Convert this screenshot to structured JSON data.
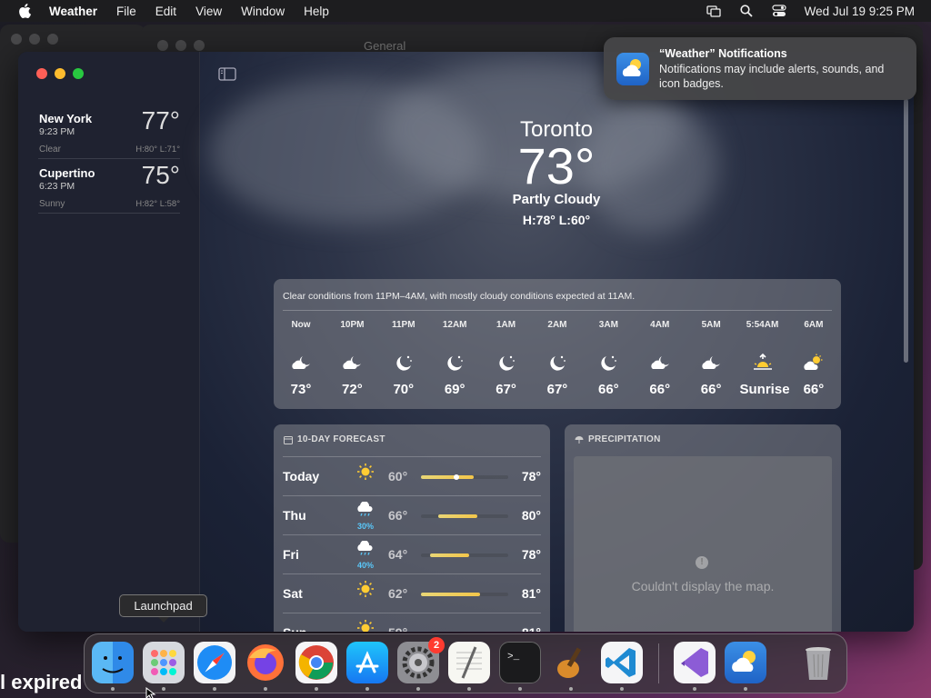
{
  "menubar": {
    "app_name": "Weather",
    "items": [
      "File",
      "Edit",
      "View",
      "Window",
      "Help"
    ],
    "datetime": "Wed Jul 19  9:25 PM"
  },
  "background_window": {
    "title": "General"
  },
  "desktop_text": "l expired",
  "sidebar": {
    "cities": [
      {
        "name": "New York",
        "time": "9:23 PM",
        "temp": "77°",
        "condition": "Clear",
        "hilo": "H:80°  L:71°"
      },
      {
        "name": "Cupertino",
        "time": "6:23 PM",
        "temp": "75°",
        "condition": "Sunny",
        "hilo": "H:82°  L:58°"
      }
    ]
  },
  "current": {
    "location": "Toronto",
    "temp": "73°",
    "condition": "Partly Cloudy",
    "hilo": "H:78°  L:60°"
  },
  "hourly": {
    "summary": "Clear conditions from 11PM–4AM, with mostly cloudy conditions expected at 11AM.",
    "hours": [
      {
        "label": "Now",
        "icon": "cloud-moon-icon",
        "temp": "73°"
      },
      {
        "label": "10PM",
        "icon": "cloud-moon-icon",
        "temp": "72°"
      },
      {
        "label": "11PM",
        "icon": "moon-stars-icon",
        "temp": "70°"
      },
      {
        "label": "12AM",
        "icon": "moon-stars-icon",
        "temp": "69°"
      },
      {
        "label": "1AM",
        "icon": "moon-stars-icon",
        "temp": "67°"
      },
      {
        "label": "2AM",
        "icon": "moon-stars-icon",
        "temp": "67°"
      },
      {
        "label": "3AM",
        "icon": "moon-stars-icon",
        "temp": "66°"
      },
      {
        "label": "4AM",
        "icon": "cloud-moon-icon",
        "temp": "66°"
      },
      {
        "label": "5AM",
        "icon": "cloud-moon-icon",
        "temp": "66°"
      },
      {
        "label": "5:54AM",
        "icon": "sunrise-icon",
        "temp": "Sunrise"
      },
      {
        "label": "6AM",
        "icon": "cloud-sun-icon",
        "temp": "66°"
      }
    ]
  },
  "forecast": {
    "title": "10-DAY FORECAST",
    "days": [
      {
        "name": "Today",
        "icon": "sun-icon",
        "pct": "",
        "low": "60°",
        "high": "78°",
        "bar_start": 0.0,
        "bar_end": 0.6,
        "current": 0.41
      },
      {
        "name": "Thu",
        "icon": "cloud-rain-icon",
        "pct": "30%",
        "low": "66°",
        "high": "80°",
        "bar_start": 0.2,
        "bar_end": 0.65
      },
      {
        "name": "Fri",
        "icon": "cloud-rain-icon",
        "pct": "40%",
        "low": "64°",
        "high": "78°",
        "bar_start": 0.1,
        "bar_end": 0.55
      },
      {
        "name": "Sat",
        "icon": "sun-icon",
        "pct": "",
        "low": "62°",
        "high": "81°",
        "bar_start": 0.0,
        "bar_end": 0.68
      },
      {
        "name": "Sun",
        "icon": "sun-icon",
        "pct": "",
        "low": "59°",
        "high": "81°",
        "bar_start": 0.0,
        "bar_end": 0.7
      }
    ]
  },
  "precipitation": {
    "title": "PRECIPITATION",
    "message": "Couldn't display the map."
  },
  "notification": {
    "title": "“Weather” Notifications",
    "body": "Notifications may include alerts, sounds, and icon badges."
  },
  "tooltip": "Launchpad",
  "dock": {
    "apps": [
      "Finder",
      "Launchpad",
      "Safari",
      "Firefox",
      "Chrome",
      "App Store",
      "System Settings",
      "TextEdit",
      "Terminal",
      "GarageBand",
      "VS Code",
      "Visual Studio",
      "Weather",
      "Trash"
    ],
    "settings_badge": "2"
  }
}
